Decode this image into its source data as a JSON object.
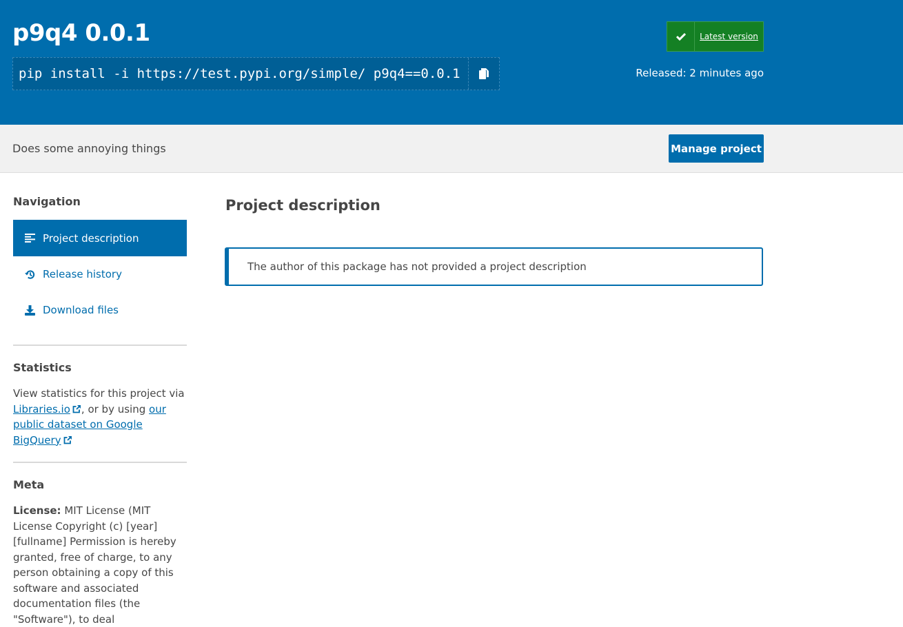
{
  "header": {
    "title": "p9q4 0.0.1",
    "pip_command": "pip install -i https://test.pypi.org/simple/ p9q4==0.0.1",
    "latest_label": "Latest version",
    "released": "Released: 2 minutes ago"
  },
  "summary": {
    "text": "Does some annoying things",
    "manage_label": "Manage project"
  },
  "sidebar": {
    "nav_heading": "Navigation",
    "nav_items": [
      {
        "label": "Project description",
        "icon": "align-left-icon",
        "active": true
      },
      {
        "label": "Release history",
        "icon": "history-icon",
        "active": false
      },
      {
        "label": "Download files",
        "icon": "download-icon",
        "active": false
      }
    ],
    "stats_heading": "Statistics",
    "stats_prefix": "View statistics for this project via",
    "stats_link1": "Libraries.io",
    "stats_middle": ", or by using",
    "stats_link2": "our public dataset on Google BigQuery",
    "meta_heading": "Meta",
    "license_label": "License:",
    "license_text": "MIT License (MIT License Copyright (c) [year] [fullname] Permission is hereby granted, free of charge, to any person obtaining a copy of this software and associated documentation files (the \"Software\"), to deal"
  },
  "main": {
    "heading": "Project description",
    "callout": "The author of this package has not provided a project description"
  },
  "colors": {
    "brand_blue": "#006dad",
    "latest_green": "#148024",
    "summary_bg": "#f1f1f1"
  }
}
